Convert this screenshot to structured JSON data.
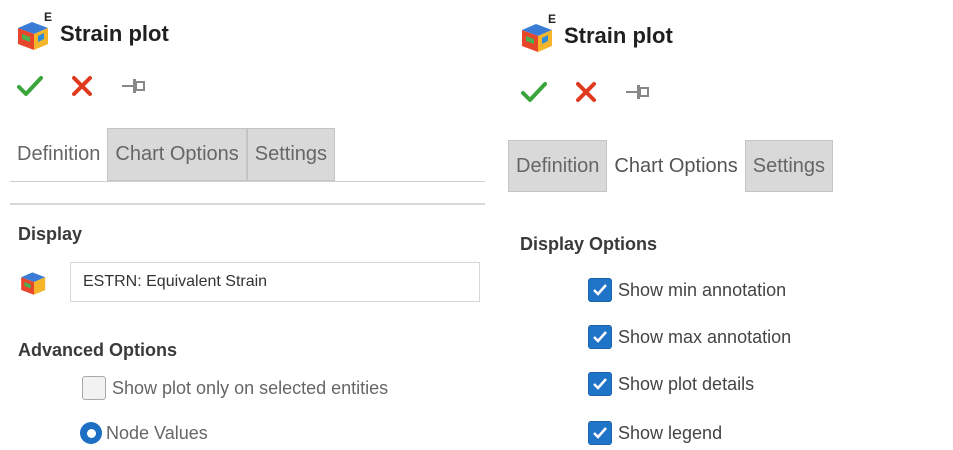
{
  "left_panel": {
    "title": "Strain plot",
    "title_icon_sup": "E",
    "tabs": [
      {
        "label": "Definition",
        "state": "active"
      },
      {
        "label": "Chart Options",
        "state": "inactive"
      },
      {
        "label": "Settings",
        "state": "inactive"
      }
    ],
    "display_heading": "Display",
    "display_value": "ESTRN: Equivalent Strain",
    "advanced_heading": "Advanced Options",
    "show_selected_label": "Show plot only on selected entities",
    "show_selected_checked": false,
    "node_values_label": "Node Values",
    "node_values_selected": true
  },
  "right_panel": {
    "title": "Strain plot",
    "title_icon_sup": "E",
    "tabs": [
      {
        "label": "Definition",
        "state": "inactive"
      },
      {
        "label": "Chart Options",
        "state": "active"
      },
      {
        "label": "Settings",
        "state": "inactive"
      }
    ],
    "display_options_heading": "Display Options",
    "options": [
      {
        "label": "Show min annotation",
        "checked": true
      },
      {
        "label": "Show max annotation",
        "checked": true
      },
      {
        "label": "Show plot details",
        "checked": true
      },
      {
        "label": "Show legend",
        "checked": true
      }
    ]
  },
  "icons": {
    "ok": "checkmark-icon",
    "cancel": "close-icon",
    "pin": "pushpin-icon",
    "plot": "strain-plot-icon"
  },
  "colors": {
    "ok_green": "#3aa53a",
    "cancel_red": "#e03a1e",
    "checkbox_blue": "#1f74c7",
    "tab_inactive": "#d9d9d9"
  }
}
